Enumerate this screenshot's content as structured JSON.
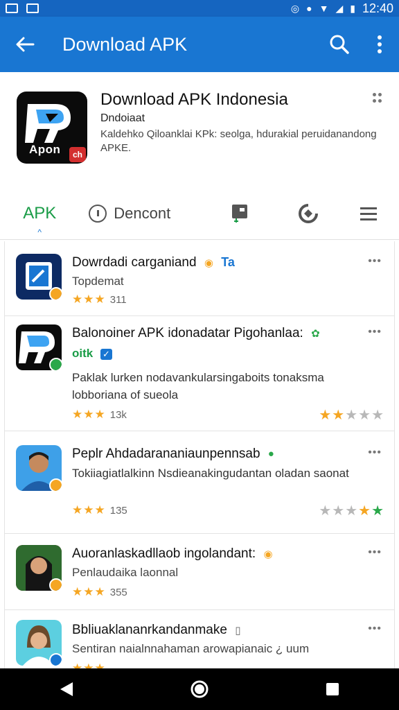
{
  "status_bar": {
    "time": "12:40"
  },
  "app_bar": {
    "title": "Download APK"
  },
  "header": {
    "title": "Download APK Indonesia",
    "subtitle": "Dndoiaat",
    "description": "Kaldehko Qiloanklai KPk: seolga, hdurakial peruidanandong APKE.",
    "logo_text": "Apon",
    "logo_badge": "ch"
  },
  "tabs": [
    {
      "label": "APK"
    },
    {
      "label": "Dencont"
    }
  ],
  "list": [
    {
      "title": "Dowrdadi carganiand",
      "tag": "Ta",
      "subtitle": "Topdemat",
      "rating_count": "311",
      "thumb_color": "#0d2a63"
    },
    {
      "title": "Balonoiner APK idonadatar Pigohanlaa:",
      "tag": "oitk",
      "description": "Paklak lurken nodavankularsingaboits tonaksma lobboriana of sueola",
      "rating_count": "13k",
      "thumb_color": "#0b0b0b"
    },
    {
      "title": "Peplr Ahdadarananiaunpennsab",
      "description": "Tokiiagiatlalkinn Nsdieanakingudantan oladan saonat",
      "rating_count": "135"
    },
    {
      "title": "Auoranlaskadllaob ingolandant:",
      "subtitle": "Penlaudaika laonnal",
      "rating_count": "355"
    },
    {
      "title": "Bbliuaklananrkandanmake",
      "subtitle": "Sentiran naialnnahaman arowapianaic ¿ uum"
    }
  ],
  "colors": {
    "app_bar": "#1976d2",
    "status_bar": "#1565c0",
    "accent_green": "#1a9c47",
    "star": "#f5a623"
  }
}
